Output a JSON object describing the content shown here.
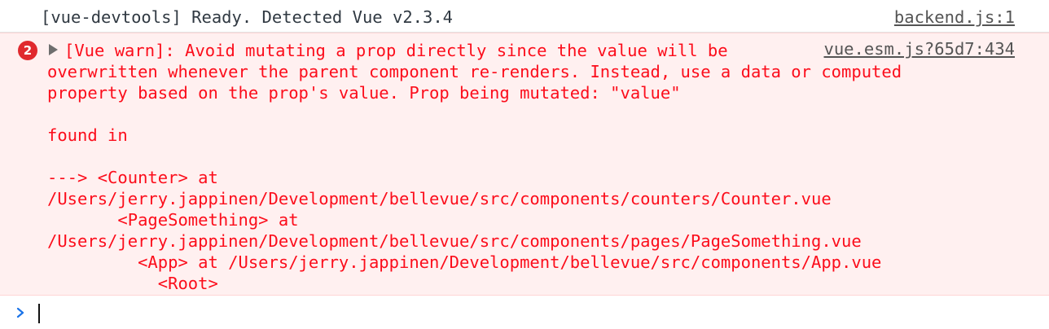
{
  "log_message": {
    "text": "[vue-devtools] Ready. Detected Vue v2.3.4",
    "source": "backend.js:1"
  },
  "error_message": {
    "count": "2",
    "source": "vue.esm.js?65d7:434",
    "lines": [
      "[Vue warn]: Avoid mutating a prop directly since the value will be",
      "overwritten whenever the parent component re-renders. Instead, use a data or computed",
      "property based on the prop's value. Prop being mutated: \"value\"",
      "",
      "found in",
      "",
      "---> <Counter> at",
      "/Users/jerry.jappinen/Development/bellevue/src/components/counters/Counter.vue",
      "       <PageSomething> at",
      "/Users/jerry.jappinen/Development/bellevue/src/components/pages/PageSomething.vue",
      "         <App> at /Users/jerry.jappinen/Development/bellevue/src/components/App.vue",
      "           <Root>"
    ]
  },
  "prompt": {
    "icon": "chevron-right-icon",
    "value": ""
  },
  "colors": {
    "error_text": "#fc0d1b",
    "error_background": "#fff0f0",
    "error_border": "#ffd6d6",
    "badge": "#e0292e",
    "log_text": "#303942",
    "prompt_accent": "#1a73e8"
  }
}
